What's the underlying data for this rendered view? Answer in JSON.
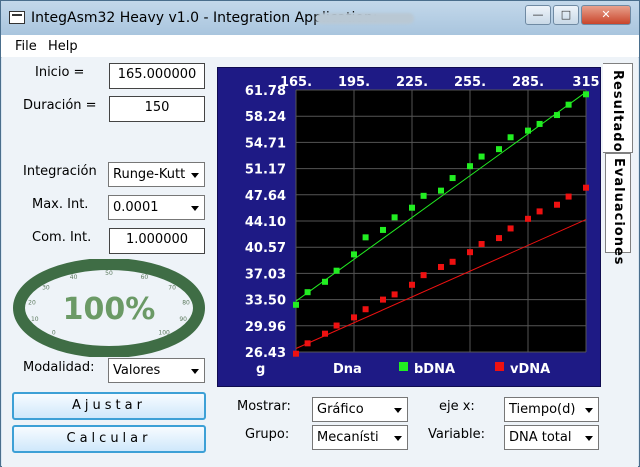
{
  "window": {
    "title": "IntegAsm32 Heavy v1.0 - Integration Application:",
    "buttons": {
      "minimize": "—",
      "maximize": "□",
      "close": "✕"
    }
  },
  "menu": {
    "file": "File",
    "help": "Help"
  },
  "left": {
    "inicio_label": "Inicio =",
    "inicio_value": "165.000000",
    "duracion_label": "Duración =",
    "duracion_value": "150",
    "integracion_label": "Integración",
    "integracion_value": "Runge-Kutt",
    "maxint_label": "Max. Int.",
    "maxint_value": "0.0001",
    "comint_label": "Com. Int.",
    "comint_value": "1.000000",
    "progress_percent": 100,
    "progress_text": "100%",
    "gauge_ticks": [
      "0",
      "10",
      "20",
      "30",
      "40",
      "50",
      "60",
      "70",
      "80",
      "90",
      "100"
    ],
    "modalidad_label": "Modalidad:",
    "modalidad_value": "Valores",
    "ajustar_label": "Ajustar",
    "calcular_label": "Calcular"
  },
  "tabs": {
    "resultados": "Resultados",
    "evaluaciones": "Evaluaciones"
  },
  "controls": {
    "mostrar_label": "Mostrar:",
    "mostrar_value": "Gráfico",
    "grupo_label": "Grupo:",
    "grupo_value": "Mecanísti",
    "ejex_label": "eje x:",
    "ejex_value": "Tiempo(d)",
    "variable_label": "Variable:",
    "variable_value": "DNA total"
  },
  "chart_data": {
    "type": "scatter",
    "x_ticks": [
      "165.",
      "195.",
      "225.",
      "255.",
      "285.",
      "315"
    ],
    "y_ticks": [
      "61.78",
      "58.24",
      "54.71",
      "51.17",
      "47.64",
      "44.10",
      "40.57",
      "37.03",
      "33.50",
      "29.96",
      "26.43"
    ],
    "xlim": [
      165,
      315
    ],
    "ylim": [
      26.43,
      61.78
    ],
    "grid": true,
    "ylabel": "g",
    "legend_title": "Dna",
    "series": [
      {
        "name": "bDNA",
        "color": "#22ee22",
        "x": [
          165,
          171,
          180,
          186,
          195,
          201,
          210,
          216,
          225,
          231,
          240,
          246,
          255,
          261,
          270,
          276,
          285,
          291,
          300,
          306,
          315
        ],
        "y": [
          32.8,
          34.5,
          35.9,
          37.4,
          39.6,
          41.9,
          42.9,
          44.6,
          45.9,
          47.5,
          48.2,
          49.9,
          51.5,
          52.8,
          53.8,
          55.4,
          56.3,
          57.2,
          58.4,
          59.8,
          61.2
        ],
        "fit": [
          [
            165,
            33.3
          ],
          [
            315,
            61.5
          ]
        ]
      },
      {
        "name": "vDNA",
        "color": "#ee1111",
        "x": [
          165,
          171,
          180,
          186,
          195,
          201,
          210,
          216,
          225,
          231,
          240,
          246,
          255,
          261,
          270,
          276,
          285,
          291,
          300,
          306,
          315
        ],
        "y": [
          26.2,
          27.6,
          28.9,
          30.0,
          31.1,
          32.2,
          33.5,
          34.2,
          35.5,
          36.8,
          37.9,
          38.6,
          39.9,
          41.0,
          41.8,
          43.1,
          44.4,
          45.4,
          46.3,
          47.4,
          48.6
        ],
        "fit": [
          [
            165,
            26.9
          ],
          [
            315,
            44.3
          ]
        ]
      }
    ]
  }
}
